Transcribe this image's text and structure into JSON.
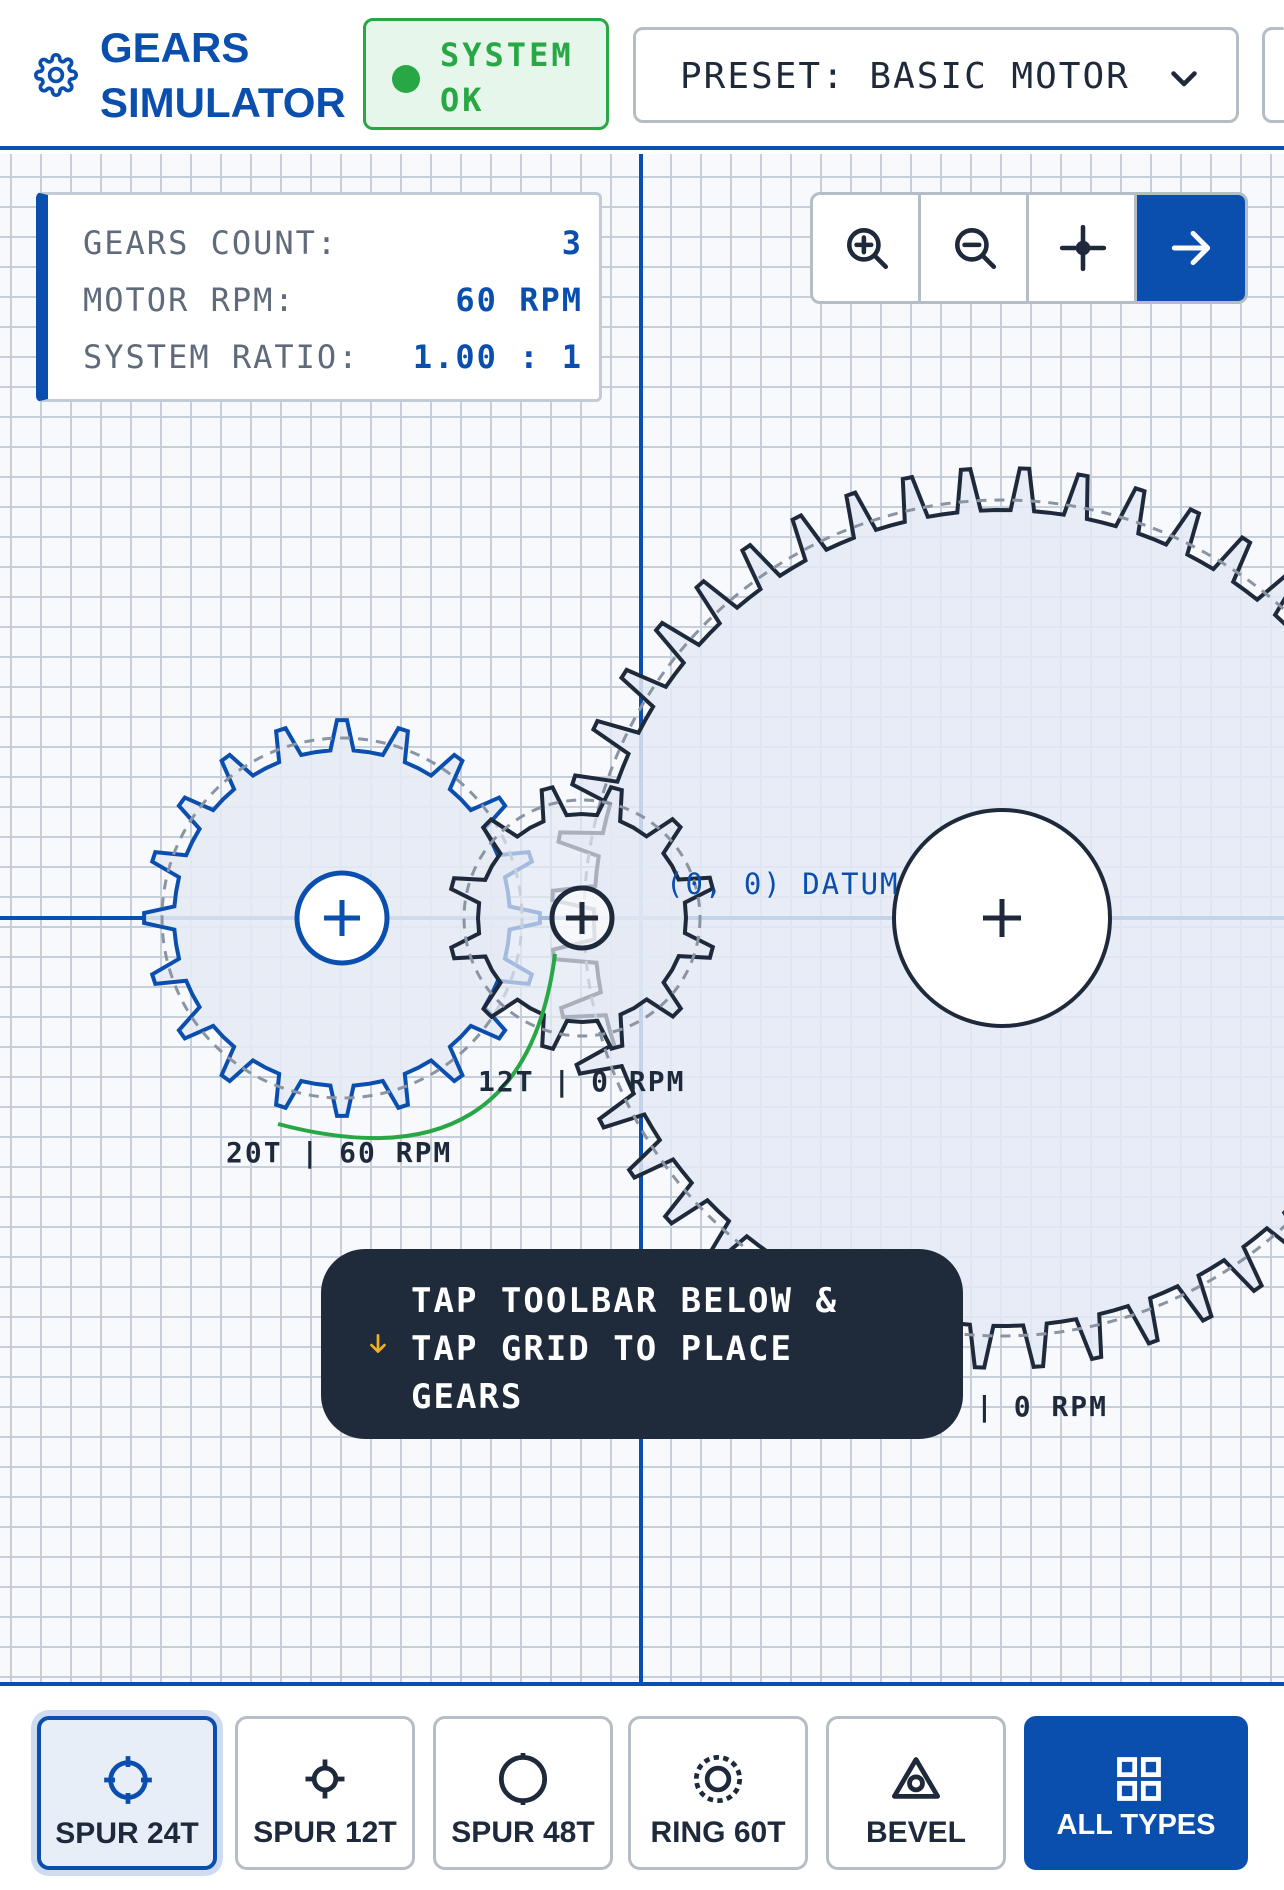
{
  "header": {
    "title": "GEARS SIMULATOR",
    "status": "SYSTEM OK",
    "preset_label": "PRESET: BASIC MOTOR",
    "logo_icon": "gear-icon",
    "colors": {
      "accent": "#0b4fae",
      "status": "#27a845"
    }
  },
  "stats": {
    "gears_count_label": "GEARS COUNT:",
    "gears_count_value": "3",
    "motor_rpm_label": "MOTOR RPM:",
    "motor_rpm_value": "60 RPM",
    "ratio_label": "SYSTEM RATIO:",
    "ratio_value": "1.00 : 1"
  },
  "zoom_controls": {
    "icons": [
      "zoom-in-icon",
      "zoom-out-icon",
      "center-icon",
      "arrow-right-icon"
    ]
  },
  "canvas": {
    "datum_label": "(0, 0) DATUM",
    "gears": [
      {
        "label": "20T | 60 RPM",
        "teeth": 20
      },
      {
        "label": "12T | 0 RPM",
        "teeth": 12
      },
      {
        "label": "| 0 RPM",
        "teeth": 48
      }
    ]
  },
  "tooltip": {
    "text": "TAP TOOLBAR BELOW & TAP GRID TO PLACE GEARS",
    "icon": "arrow-down-icon"
  },
  "toolbar": {
    "items": [
      {
        "label": "SPUR 24T",
        "icon": "spur-24-icon",
        "selected": true
      },
      {
        "label": "SPUR 12T",
        "icon": "spur-12-icon"
      },
      {
        "label": "SPUR 48T",
        "icon": "spur-48-icon"
      },
      {
        "label": "RING 60T",
        "icon": "ring-icon"
      },
      {
        "label": "BEVEL",
        "icon": "bevel-icon"
      },
      {
        "label": "ALL TYPES",
        "icon": "grid-icon"
      }
    ]
  }
}
